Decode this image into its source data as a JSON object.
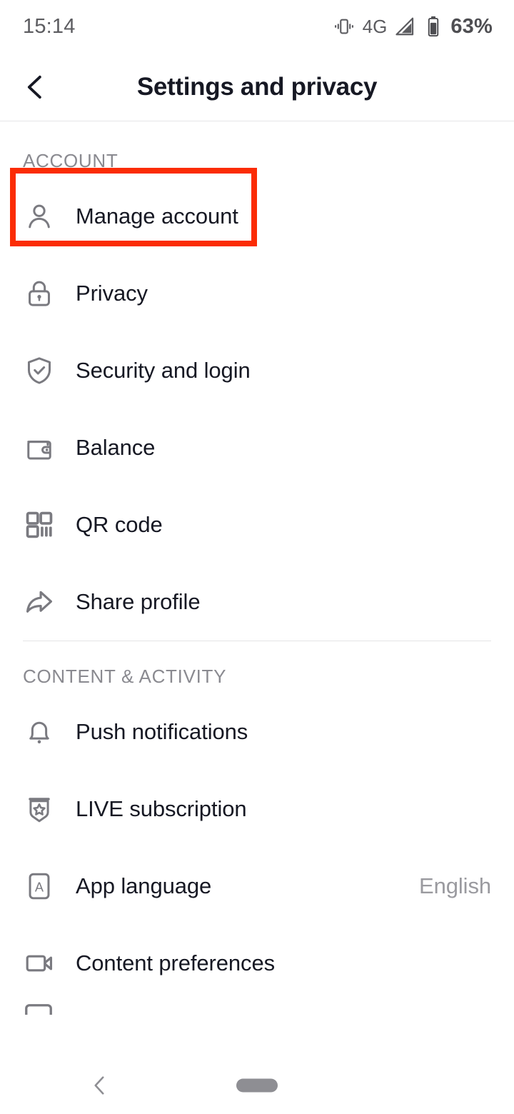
{
  "status_bar": {
    "time": "15:14",
    "network": "4G",
    "battery_percent": "63%",
    "icons": [
      "vibrate-icon",
      "signal-icon",
      "battery-icon"
    ]
  },
  "header": {
    "title": "Settings and privacy",
    "back_icon": "chevron-left-icon"
  },
  "highlight": {
    "color": "#fb2c05",
    "target": "Manage account"
  },
  "colors": {
    "text_primary": "#161823",
    "text_secondary": "#8a8a90",
    "icon": "#7a7a80",
    "divider": "#e4e4e6",
    "highlight": "#fb2c05"
  },
  "sections": [
    {
      "label": "ACCOUNT",
      "items": [
        {
          "label": "Manage account",
          "icon": "person-icon",
          "value": "",
          "highlighted": true
        },
        {
          "label": "Privacy",
          "icon": "lock-icon",
          "value": ""
        },
        {
          "label": "Security and login",
          "icon": "shield-check-icon",
          "value": ""
        },
        {
          "label": "Balance",
          "icon": "wallet-icon",
          "value": ""
        },
        {
          "label": "QR code",
          "icon": "qr-code-icon",
          "value": ""
        },
        {
          "label": "Share profile",
          "icon": "share-arrow-icon",
          "value": ""
        }
      ]
    },
    {
      "label": "CONTENT & ACTIVITY",
      "items": [
        {
          "label": "Push notifications",
          "icon": "bell-icon",
          "value": ""
        },
        {
          "label": "LIVE subscription",
          "icon": "badge-star-icon",
          "value": ""
        },
        {
          "label": "App language",
          "icon": "letter-a-box-icon",
          "value": "English"
        },
        {
          "label": "Content preferences",
          "icon": "video-camera-icon",
          "value": ""
        }
      ]
    }
  ],
  "nav_bar": {
    "back_icon": "chevron-left-icon",
    "home_icon": "home-pill-icon"
  }
}
